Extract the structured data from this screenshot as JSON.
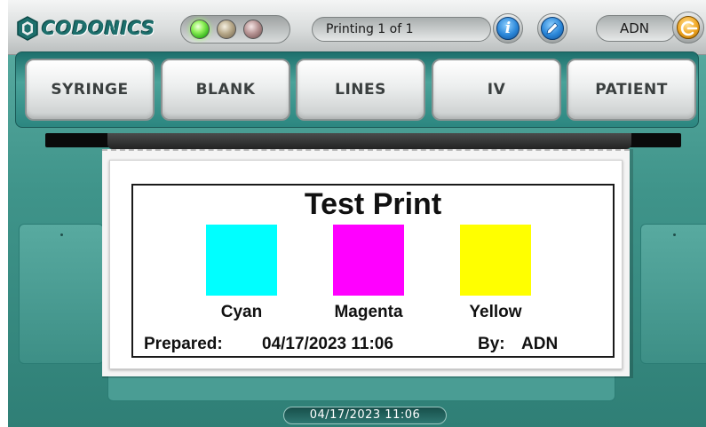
{
  "header": {
    "logo_text": "CODONICS",
    "status_text": "Printing 1 of 1",
    "user": "ADN",
    "indicator_lights": [
      {
        "name": "ready",
        "color": "#33b41b",
        "state": "on"
      },
      {
        "name": "warning",
        "color": "#b8a98a",
        "state": "off"
      },
      {
        "name": "error",
        "color": "#b79494",
        "state": "off"
      }
    ],
    "icons": {
      "logo": "hexagon-logo-icon",
      "info": "info-icon",
      "help": "help-icon",
      "logout": "logout-icon"
    }
  },
  "toolbar": {
    "tabs": [
      {
        "label": "SYRINGE"
      },
      {
        "label": "BLANK"
      },
      {
        "label": "LINES"
      },
      {
        "label": "IV"
      },
      {
        "label": "PATIENT"
      }
    ]
  },
  "label": {
    "title": "Test Print",
    "swatches": [
      {
        "name": "Cyan",
        "color": "#00ffff"
      },
      {
        "name": "Magenta",
        "color": "#ff00ff"
      },
      {
        "name": "Yellow",
        "color": "#ffff00"
      }
    ],
    "prepared_label": "Prepared:",
    "prepared_value": "04/17/2023 11:06",
    "by_label": "By:",
    "by_value": "ADN"
  },
  "footer": {
    "datetime": "04/17/2023 11:06"
  },
  "colors": {
    "brand": "#1d6f6c",
    "background": "#3f948a"
  }
}
